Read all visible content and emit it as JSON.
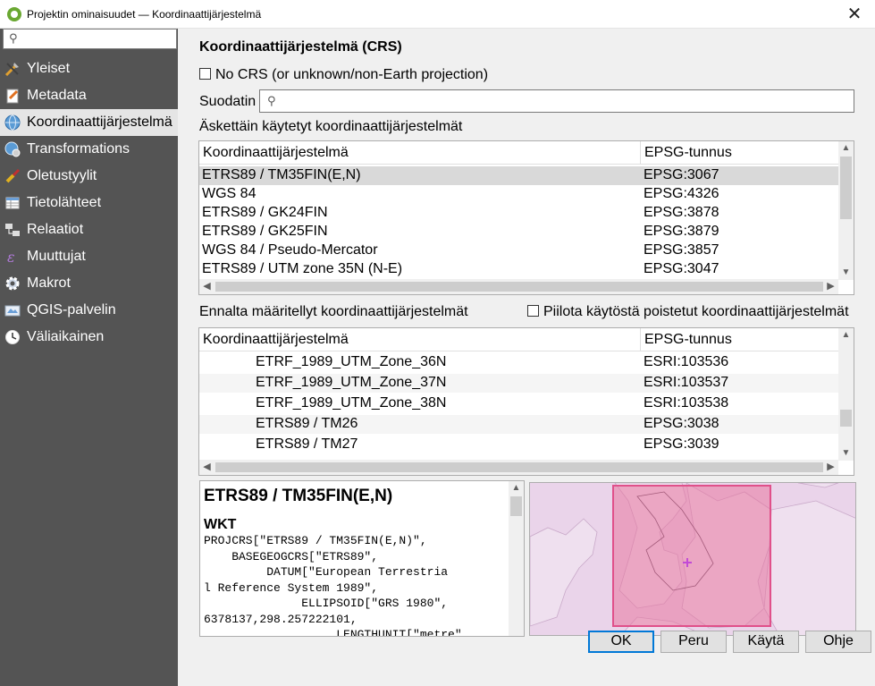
{
  "window": {
    "title": "Projektin ominaisuudet — Koordinaattijärjestelmä",
    "close_glyph": "✕"
  },
  "sidebar": {
    "search_placeholder": "",
    "items": [
      {
        "label": "Yleiset",
        "icon": "wrench-icon"
      },
      {
        "label": "Metadata",
        "icon": "document-edit-icon"
      },
      {
        "label": "Koordinaattijärjestelmä",
        "icon": "globe-icon"
      },
      {
        "label": "Transformations",
        "icon": "globe-gear-icon"
      },
      {
        "label": "Oletustyylit",
        "icon": "paint-brush-icon"
      },
      {
        "label": "Tietolähteet",
        "icon": "table-icon"
      },
      {
        "label": "Relaatiot",
        "icon": "relation-icon"
      },
      {
        "label": "Muuttujat",
        "icon": "expression-icon"
      },
      {
        "label": "Makrot",
        "icon": "gear-icon"
      },
      {
        "label": "QGIS-palvelin",
        "icon": "server-icon"
      },
      {
        "label": "Väliaikainen",
        "icon": "clock-icon"
      }
    ],
    "active_index": 2
  },
  "crs": {
    "heading": "Koordinaattijärjestelmä (CRS)",
    "no_crs_label": "No CRS (or unknown/non-Earth projection)",
    "filter_label": "Suodatin",
    "filter_value": "",
    "recent_label": "Äskettäin käytetyt koordinaattijärjestelmät",
    "predefined_label": "Ennalta määritellyt koordinaattijärjestelmät",
    "hide_deprecated_label": "Piilota käytöstä poistetut koordinaattijärjestelmät",
    "columns": {
      "name": "Koordinaattijärjestelmä",
      "id": "EPSG-tunnus"
    },
    "recent": [
      {
        "name": "ETRS89 / TM35FIN(E,N)",
        "id": "EPSG:3067"
      },
      {
        "name": "WGS 84",
        "id": "EPSG:4326"
      },
      {
        "name": "ETRS89 / GK24FIN",
        "id": "EPSG:3878"
      },
      {
        "name": "ETRS89 / GK25FIN",
        "id": "EPSG:3879"
      },
      {
        "name": "WGS 84 / Pseudo-Mercator",
        "id": "EPSG:3857"
      },
      {
        "name": "ETRS89 / UTM zone 35N (N-E)",
        "id": "EPSG:3047"
      }
    ],
    "predefined": [
      {
        "name": "ETRF_1989_UTM_Zone_36N",
        "id": "ESRI:103536"
      },
      {
        "name": "ETRF_1989_UTM_Zone_37N",
        "id": "ESRI:103537"
      },
      {
        "name": "ETRF_1989_UTM_Zone_38N",
        "id": "ESRI:103538"
      },
      {
        "name": "ETRS89 / TM26",
        "id": "EPSG:3038"
      },
      {
        "name": "ETRS89 / TM27",
        "id": "EPSG:3039"
      }
    ],
    "selected_name": "ETRS89 / TM35FIN(E,N)",
    "wkt_heading": "WKT",
    "wkt_lines": [
      "PROJCRS[\"ETRS89 / TM35FIN(E,N)\",",
      "    BASEGEOGCRS[\"ETRS89\",",
      "         DATUM[\"European Terrestria",
      "l Reference System 1989\",",
      "              ELLIPSOID[\"GRS 1980\",",
      "6378137,298.257222101,",
      "                   LENGTHUNIT[\"metre\""
    ]
  },
  "buttons": {
    "ok": "OK",
    "cancel": "Peru",
    "apply": "Käytä",
    "help": "Ohje"
  },
  "colors": {
    "sidebar_bg": "#545454",
    "selection": "#d9d9d9",
    "extent_fill": "#e8779e",
    "map_bg": "#ead4ea",
    "accent": "#0078d7"
  }
}
